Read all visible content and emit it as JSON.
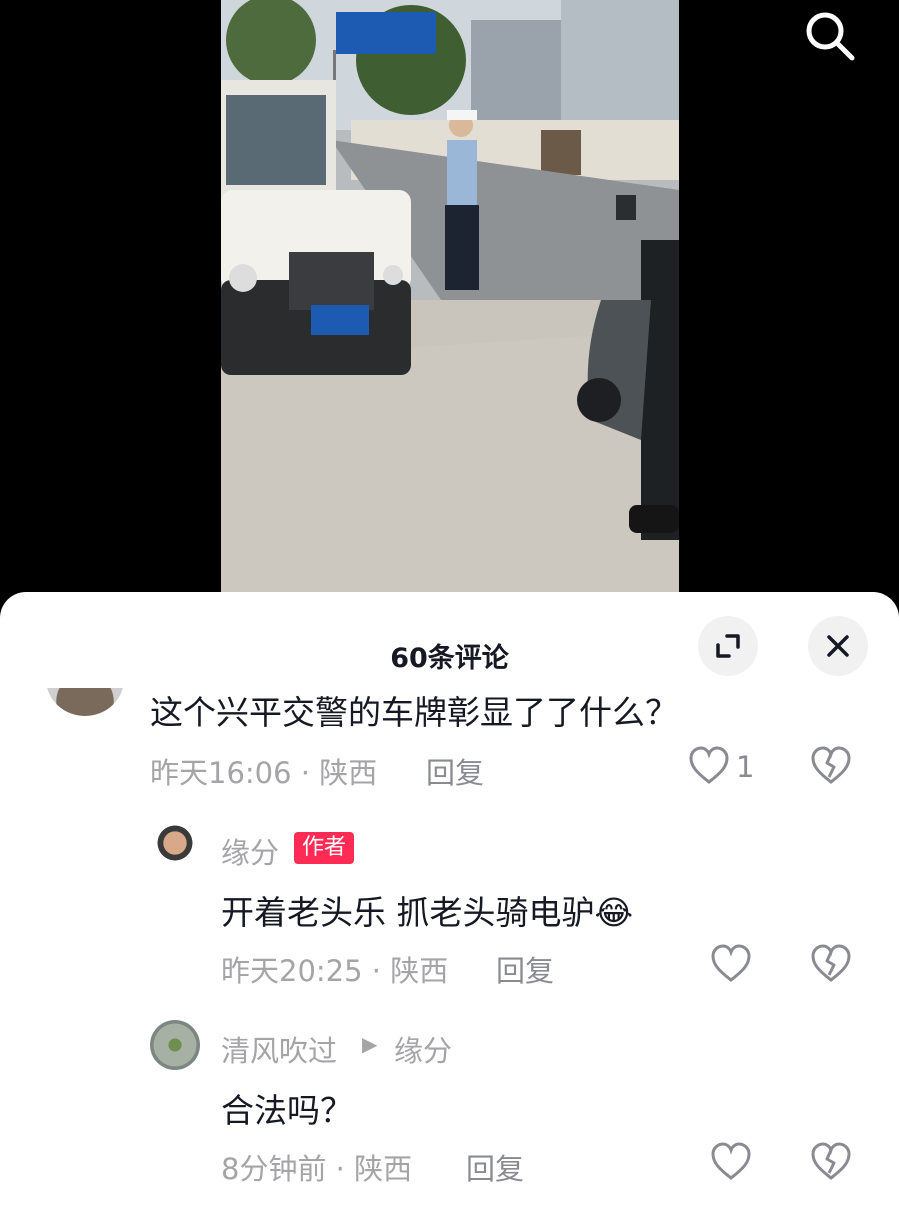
{
  "comments_panel": {
    "title": "60条评论"
  },
  "comments": [
    {
      "text": "这个兴平交警的车牌彰显了了什么？",
      "meta": "昨天16:06 · 陕西",
      "reply_label": "回复",
      "like_count": "1"
    },
    {
      "author": "缘分",
      "author_badge": "作者",
      "text": "开着老头乐 抓老头骑电驴",
      "emoji": "😂",
      "meta": "昨天20:25 · 陕西",
      "reply_label": "回复"
    },
    {
      "author": "清风吹过",
      "reply_to": "缘分",
      "text": "合法吗？",
      "meta": "8分钟前 · 陕西",
      "reply_label": "回复"
    }
  ],
  "colors": {
    "accent": "#fe2c55",
    "text": "#161823",
    "muted": "#a5a5a8"
  }
}
